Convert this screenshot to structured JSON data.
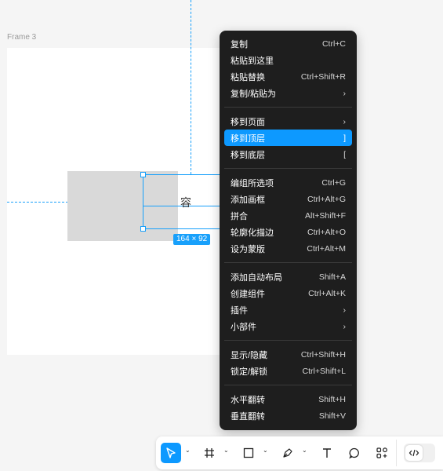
{
  "canvas": {
    "frame_label": "Frame 3",
    "text_node": "容",
    "size_badge": "164 × 92"
  },
  "context_menu": {
    "groups": [
      [
        {
          "label": "复制",
          "shortcut": "Ctrl+C"
        },
        {
          "label": "粘贴到这里",
          "shortcut": ""
        },
        {
          "label": "粘贴替换",
          "shortcut": "Ctrl+Shift+R"
        },
        {
          "label": "复制/粘贴为",
          "shortcut": "›"
        }
      ],
      [
        {
          "label": "移到页面",
          "shortcut": "›"
        },
        {
          "label": "移到顶层",
          "shortcut": "]"
        },
        {
          "label": "移到底层",
          "shortcut": "["
        }
      ],
      [
        {
          "label": "编组所选项",
          "shortcut": "Ctrl+G"
        },
        {
          "label": "添加画框",
          "shortcut": "Ctrl+Alt+G"
        },
        {
          "label": "拼合",
          "shortcut": "Alt+Shift+F"
        },
        {
          "label": "轮廓化描边",
          "shortcut": "Ctrl+Alt+O"
        },
        {
          "label": "设为蒙版",
          "shortcut": "Ctrl+Alt+M"
        }
      ],
      [
        {
          "label": "添加自动布局",
          "shortcut": "Shift+A"
        },
        {
          "label": "创建组件",
          "shortcut": "Ctrl+Alt+K"
        },
        {
          "label": "插件",
          "shortcut": "›"
        },
        {
          "label": "小部件",
          "shortcut": "›"
        }
      ],
      [
        {
          "label": "显示/隐藏",
          "shortcut": "Ctrl+Shift+H"
        },
        {
          "label": "锁定/解锁",
          "shortcut": "Ctrl+Shift+L"
        }
      ],
      [
        {
          "label": "水平翻转",
          "shortcut": "Shift+H"
        },
        {
          "label": "垂直翻转",
          "shortcut": "Shift+V"
        }
      ]
    ],
    "highlighted_item": "移到顶层"
  },
  "toolbar": {
    "tools": [
      "move-tool",
      "frame-tool",
      "shape-tool",
      "pen-tool",
      "text-tool",
      "comment-tool",
      "actions-tool"
    ],
    "active_tool": "move-tool",
    "dev_mode_icon": "code-icon"
  },
  "colors": {
    "accent": "#0d99ff",
    "menu_bg": "#1e1e1e",
    "selection": "#18a0fb"
  }
}
